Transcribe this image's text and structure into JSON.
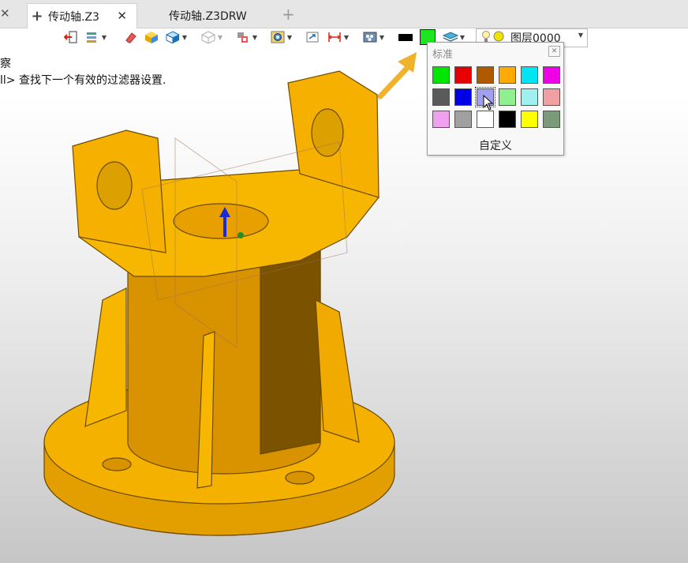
{
  "tabs": [
    {
      "label": "传动轴.Z3",
      "active": true
    },
    {
      "label": "传动轴.Z3DRW",
      "active": false
    }
  ],
  "toolbar": {
    "icons": [
      "exit-icon",
      "layers-list-icon",
      "eraser-icon",
      "cube-shaded-icon",
      "cube-wire-icon",
      "cube-hidden-icon",
      "paint-icon",
      "view-icon",
      "zoom-fit-icon",
      "dimension-icon",
      "render-icon"
    ],
    "line_color": "#000000",
    "face_color": "#1ee61e",
    "layer_name": "图层0000"
  },
  "messages": {
    "line1": "察",
    "line2": "ll> 查找下一个有效的过滤器设置."
  },
  "color_popup": {
    "title": "标准",
    "custom_label": "自定义",
    "colors": [
      "#00e600",
      "#e60000",
      "#b05a00",
      "#ffaa00",
      "#00e6f0",
      "#f000e6",
      "#5a5a5a",
      "#0000e6",
      "#a0a0f0",
      "#90f090",
      "#a0f0f0",
      "#f0a0a0",
      "#f0a0f0",
      "#a0a0a0",
      "#ffffff",
      "#000000",
      "#ffff00",
      "#7a9a7a"
    ],
    "selected_index": 8
  },
  "colors": {
    "model": "#f2a900",
    "arrow": "#f0b22a"
  }
}
